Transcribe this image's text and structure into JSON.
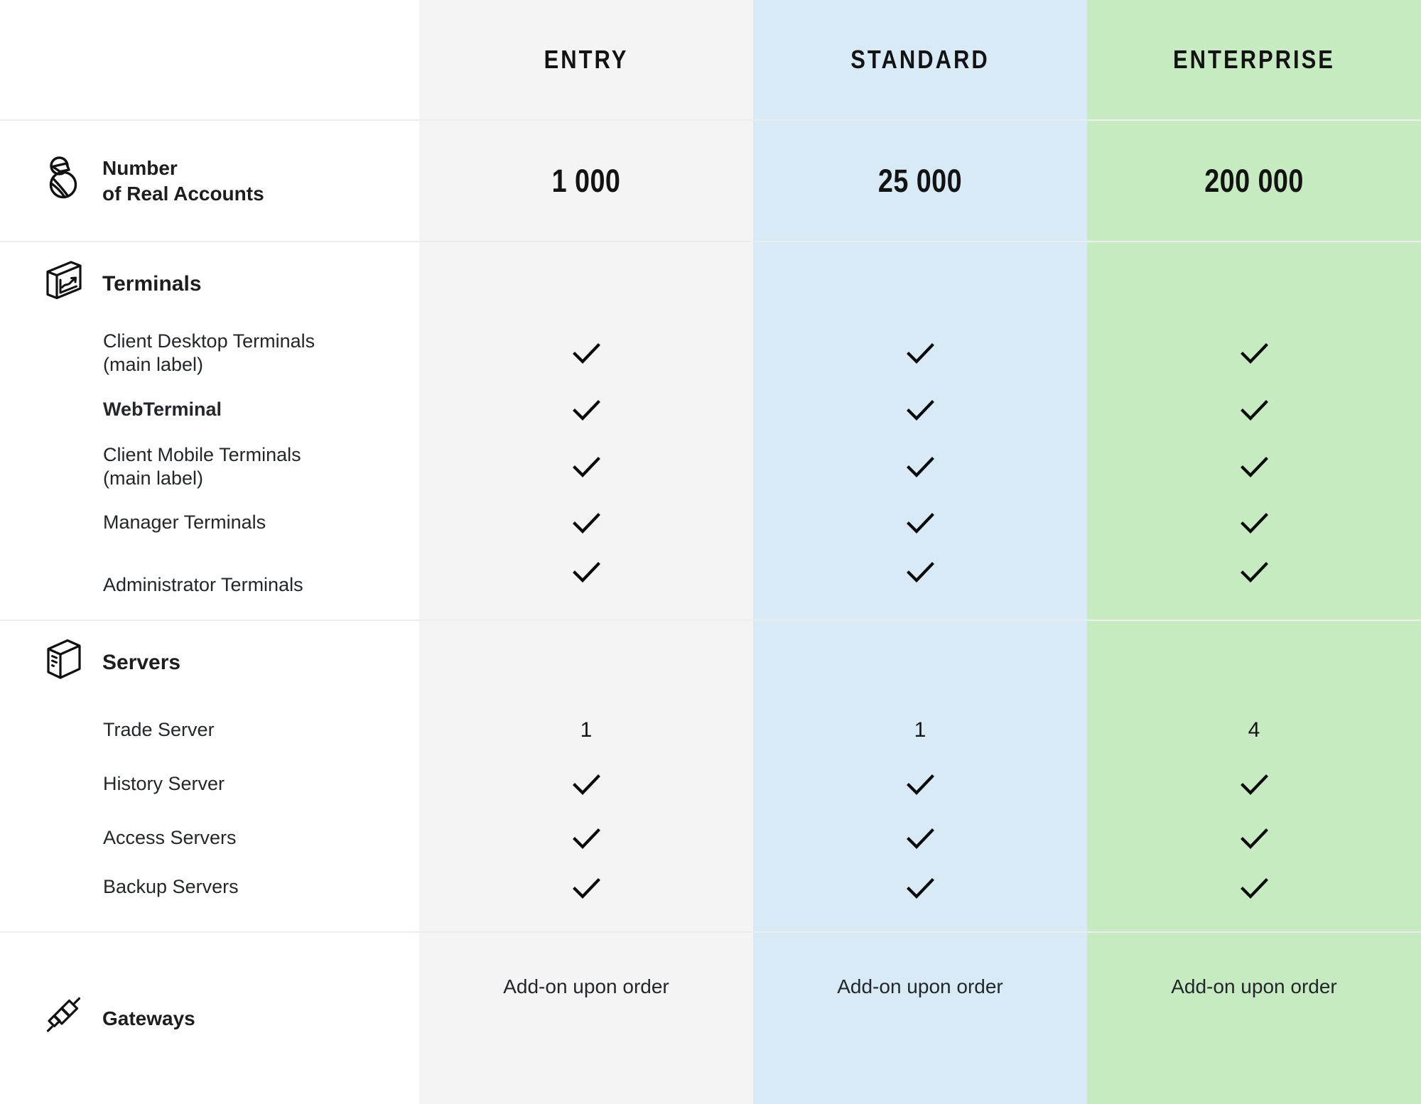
{
  "columns": [
    {
      "key": "label",
      "label": ""
    },
    {
      "key": "entry",
      "label": "ENTRY",
      "bg": "#f4f4f4"
    },
    {
      "key": "standard",
      "label": "STANDARD",
      "bg": "#d9eaf7"
    },
    {
      "key": "enterprise",
      "label": "ENTERPRISE",
      "bg": "#c6ebc0"
    }
  ],
  "sections": [
    {
      "id": "accounts",
      "icon": "account-icon",
      "title": "Number\nof Real Accounts",
      "title_line1": "Number",
      "title_line2": "of Real Accounts",
      "values": {
        "entry": "1 000",
        "standard": "25 000",
        "enterprise": "200 000"
      }
    },
    {
      "id": "terminals",
      "icon": "terminal-window-icon",
      "title": "Terminals",
      "rows": [
        {
          "label": "Client Desktop Terminals\n(main label)",
          "label_line1": "Client Desktop Terminals",
          "label_line2": "(main label)",
          "bold": false,
          "entry": "check",
          "standard": "check",
          "enterprise": "check"
        },
        {
          "label": "WebTerminal",
          "label_line1": "WebTerminal",
          "label_line2": "",
          "bold": true,
          "entry": "check",
          "standard": "check",
          "enterprise": "check"
        },
        {
          "label": "Client Mobile Terminals\n(main label)",
          "label_line1": "Client Mobile Terminals",
          "label_line2": "(main label)",
          "bold": false,
          "entry": "check",
          "standard": "check",
          "enterprise": "check"
        },
        {
          "label": "Manager Terminals",
          "label_line1": "Manager Terminals",
          "label_line2": "",
          "bold": false,
          "entry": "check",
          "standard": "check",
          "enterprise": "check"
        },
        {
          "label": "Administrator Terminals",
          "label_line1": "Administrator Terminals",
          "label_line2": "",
          "bold": false,
          "entry": "check",
          "standard": "check",
          "enterprise": "check"
        }
      ]
    },
    {
      "id": "servers",
      "icon": "server-box-icon",
      "title": "Servers",
      "rows": [
        {
          "label": "Trade Server",
          "label_line1": "Trade Server",
          "label_line2": "",
          "bold": false,
          "entry": "1",
          "standard": "1",
          "enterprise": "4"
        },
        {
          "label": "History Server",
          "label_line1": "History Server",
          "label_line2": "",
          "bold": false,
          "entry": "check",
          "standard": "check",
          "enterprise": "check"
        },
        {
          "label": "Access Servers",
          "label_line1": "Access Servers",
          "label_line2": "",
          "bold": false,
          "entry": "check",
          "standard": "check",
          "enterprise": "check"
        },
        {
          "label": "Backup Servers",
          "label_line1": "Backup Servers",
          "label_line2": "",
          "bold": false,
          "entry": "check",
          "standard": "check",
          "enterprise": "check"
        }
      ]
    },
    {
      "id": "gateways",
      "icon": "gateway-connector-icon",
      "title": "Gateways",
      "values": {
        "entry": "Add-on upon order",
        "standard": "Add-on upon order",
        "enterprise": "Add-on upon order"
      }
    }
  ],
  "colors": {
    "entry_bg": "#f4f4f4",
    "standard_bg": "#d9eaf7",
    "enterprise_bg": "#c6ebc0",
    "text": "#1d1d1d",
    "divider": "#eceded",
    "check": "#0a0a0a"
  }
}
